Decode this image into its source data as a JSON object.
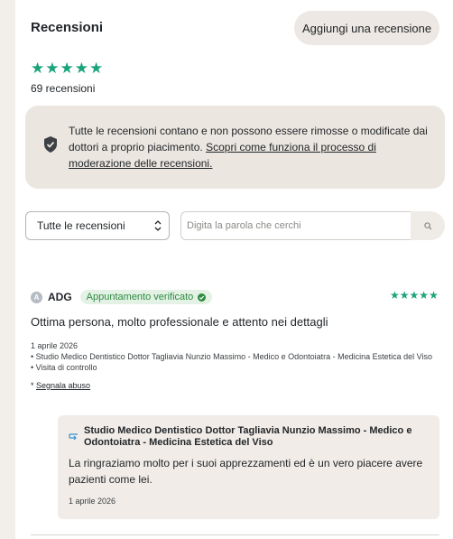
{
  "header": {
    "title": "Recensioni",
    "add_review_label": "Aggiungi una recensione"
  },
  "summary": {
    "rating": 5,
    "review_count": "69 recensioni"
  },
  "info": {
    "text": "Tutte le recensioni contano e non possono essere rimosse o modificate dai dottori a proprio piacimento. ",
    "link": "Scopri come funziona il processo di moderazione delle recensioni.",
    "icon": "shield-check-icon"
  },
  "filters": {
    "selected": "Tutte le recensioni",
    "search_placeholder": "Digita la parola che cerchi",
    "search_icon": "search-icon"
  },
  "review": {
    "avatar_initial": "A",
    "author": "ADG",
    "badge": "Appuntamento verificato",
    "rating": 5,
    "title": "Ottima persona, molto professionale e attento nei dettagli",
    "date": "1 aprile 2026",
    "location": "Studio Medico Dentistico Dottor Tagliavia Nunzio Massimo - Medico e Odontoiatra - Medicina Estetica del Viso",
    "visit": "Visita di controllo",
    "report_label": "Segnala abuso"
  },
  "reply": {
    "author": "Studio Medico Dentistico Dottor Tagliavia Nunzio Massimo - Medico e Odontoiatra - Medicina Estetica del Viso",
    "text": "La ringraziamo molto per i suoi apprezzamenti ed è un vero piacere avere pazienti come lei.",
    "date": "1 aprile 2026"
  },
  "colors": {
    "star": "#1ba37a",
    "verified": "#2f8a41",
    "background": "#f2eeea",
    "info_box": "#ebe6e0"
  }
}
